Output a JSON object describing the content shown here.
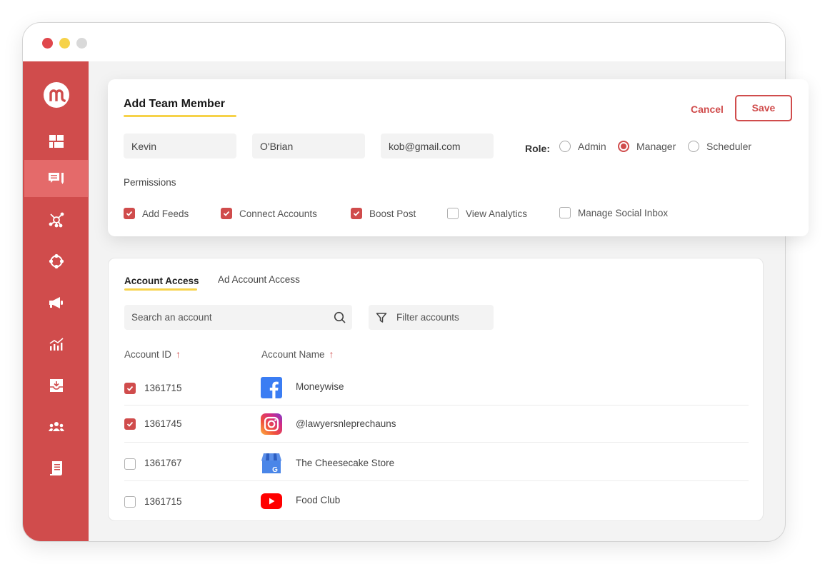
{
  "window": {
    "controls": [
      "close",
      "minimize",
      "maximize"
    ]
  },
  "sidebar": {
    "logo": "m-logo",
    "items": [
      {
        "name": "dashboard",
        "icon": "dashboard-grid-icon",
        "active": false
      },
      {
        "name": "feeds",
        "icon": "chat-edit-icon",
        "active": true
      },
      {
        "name": "connections",
        "icon": "network-hub-icon",
        "active": false
      },
      {
        "name": "community",
        "icon": "circle-nodes-icon",
        "active": false
      },
      {
        "name": "campaigns",
        "icon": "megaphone-icon",
        "active": false
      },
      {
        "name": "analytics",
        "icon": "bar-chart-trend-icon",
        "active": false
      },
      {
        "name": "inbox",
        "icon": "inbox-download-icon",
        "active": false
      },
      {
        "name": "team",
        "icon": "team-group-icon",
        "active": false
      },
      {
        "name": "reports",
        "icon": "document-scroll-icon",
        "active": false
      }
    ]
  },
  "member_form": {
    "title": "Add Team Member",
    "cancel_label": "Cancel",
    "save_label": "Save",
    "first_name": "Kevin",
    "last_name": "O'Brian",
    "email": "kob@gmail.com",
    "role_label": "Role:",
    "roles": [
      {
        "label": "Admin",
        "selected": false
      },
      {
        "label": "Manager",
        "selected": true
      },
      {
        "label": "Scheduler",
        "selected": false
      }
    ],
    "permissions_label": "Permissions",
    "permissions": [
      {
        "label": "Add Feeds",
        "checked": true
      },
      {
        "label": "Connect Accounts",
        "checked": true
      },
      {
        "label": "Boost Post",
        "checked": true
      },
      {
        "label": "View Analytics",
        "checked": false
      },
      {
        "label": "Manage Social Inbox",
        "checked": false
      }
    ]
  },
  "access": {
    "tabs": [
      {
        "label": "Account Access",
        "active": true
      },
      {
        "label": "Ad Account Access",
        "active": false
      }
    ],
    "search_placeholder": "Search an account",
    "filter_label": "Filter accounts",
    "columns": [
      {
        "label": "Account ID",
        "sort": "↑"
      },
      {
        "label": "Account Name",
        "sort": "↑"
      }
    ],
    "rows": [
      {
        "id": "1361715",
        "name": "Moneywise",
        "platform": "facebook",
        "checked": true
      },
      {
        "id": "1361745",
        "name": "@lawyersnleprechauns",
        "platform": "instagram",
        "checked": true
      },
      {
        "id": "1361767",
        "name": "The Cheesecake Store",
        "platform": "google-business",
        "checked": false
      },
      {
        "id": "1361715",
        "name": "Food Club",
        "platform": "youtube",
        "checked": false
      }
    ]
  },
  "colors": {
    "brand_red": "#d04c4c",
    "sidebar_active": "#e46a6a",
    "accent_yellow": "#f6d249",
    "facebook": "#3b7df3",
    "youtube": "#ff0000",
    "google_business": "#4a86e8"
  }
}
